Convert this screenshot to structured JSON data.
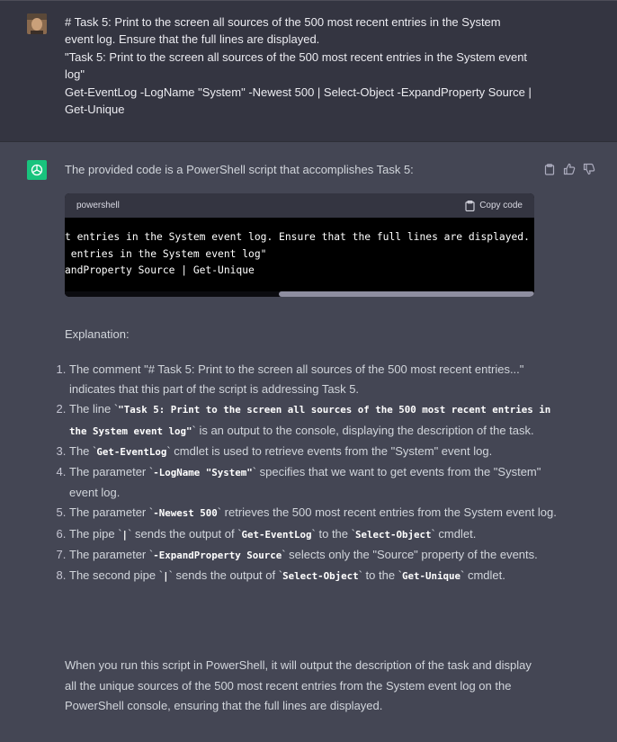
{
  "user": {
    "message": [
      "# Task 5: Print to the screen all sources of the 500 most recent entries in the System event log. Ensure that the full lines are displayed.",
      "\"Task 5: Print to the screen all sources of the 500 most recent entries in the System event log\"",
      "Get-EventLog -LogName \"System\" -Newest 500 | Select-Object -ExpandProperty Source | Get-Unique"
    ]
  },
  "assistant": {
    "intro": "The provided code is a PowerShell script that accomplishes Task 5:",
    "code_block": {
      "language": "powershell",
      "copy_label": "Copy code",
      "lines": [
        "t entries in the System event log. Ensure that the full lines are displayed.",
        " entries in the System event log\"",
        "andProperty Source | Get-Unique"
      ]
    },
    "explanation_label": "Explanation:",
    "list": [
      {
        "a": "The comment \"# Task 5: Print to the screen all sources of the 500 most recent entries...\" indicates that this part of the script is addressing Task 5."
      },
      {
        "a": "The line `",
        "c1": "\"Task 5: Print to the screen all sources of the 500 most recent entries in the System event log\"",
        "b": "` is an output to the console, displaying the description of the task."
      },
      {
        "a": "The `",
        "c1": "Get-EventLog",
        "b": "` cmdlet is used to retrieve events from the \"System\" event log."
      },
      {
        "a": "The parameter `",
        "c1": "-LogName \"System\"",
        "b": "` specifies that we want to get events from the \"System\" event log."
      },
      {
        "a": "The parameter `",
        "c1": "-Newest 500",
        "b": "` retrieves the 500 most recent entries from the System event log."
      },
      {
        "a": "The pipe `",
        "c1": "|",
        "b": "` sends the output of `",
        "c2": "Get-EventLog",
        "d": "` to the `",
        "c3": "Select-Object",
        "e": "` cmdlet."
      },
      {
        "a": "The parameter `",
        "c1": "-ExpandProperty Source",
        "b": "` selects only the \"Source\" property of the events."
      },
      {
        "a": "The second pipe `",
        "c1": "|",
        "b": "` sends the output of `",
        "c2": "Select-Object",
        "d": "` to the `",
        "c3": "Get-Unique",
        "e": "` cmdlet."
      }
    ],
    "summary": "When you run this script in PowerShell, it will output the description of the task and display all the unique sources of the 500 most recent entries from the System event log on the PowerShell console, ensuring that the full lines are displayed."
  },
  "colors": {
    "background": "#444654",
    "user_background": "#343541",
    "accent": "#19c37d"
  },
  "icons": [
    "user-avatar",
    "chatgpt-logo-icon",
    "clipboard-icon",
    "thumbs-up-icon",
    "thumbs-down-icon"
  ]
}
